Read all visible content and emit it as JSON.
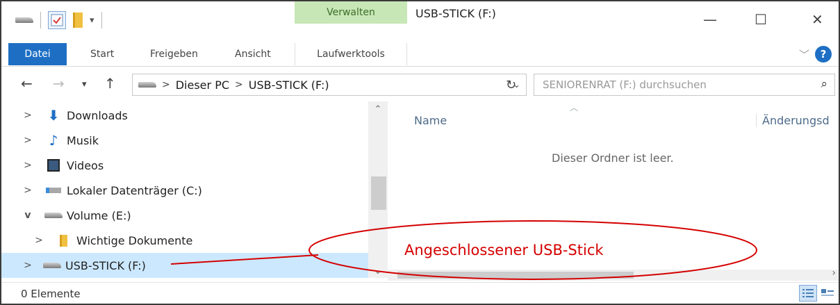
{
  "window": {
    "title": "USB-STICK (F:)",
    "contextual_group": "Verwalten",
    "controls": {
      "minimize": "—",
      "maximize": "☐",
      "close": "✕"
    }
  },
  "ribbon": {
    "tabs": [
      "Datei",
      "Start",
      "Freigeben",
      "Ansicht"
    ],
    "contextual_tab": "Laufwerktools",
    "help": "?"
  },
  "address": {
    "root": "Dieser PC",
    "current": "USB-STICK (F:)",
    "separator": ">",
    "search_placeholder": "SENIORENRAT (F:) durchsuchen"
  },
  "nav_tree": [
    {
      "label": "Downloads",
      "expander": ">",
      "icon": "download-icon",
      "indent": 0
    },
    {
      "label": "Musik",
      "expander": ">",
      "icon": "music-icon",
      "indent": 0
    },
    {
      "label": "Videos",
      "expander": ">",
      "icon": "video-icon",
      "indent": 0
    },
    {
      "label": "Lokaler Datenträger (C:)",
      "expander": ">",
      "icon": "local-drive-icon",
      "indent": 0
    },
    {
      "label": "Volume (E:)",
      "expander": "v",
      "icon": "drive-icon",
      "indent": 0
    },
    {
      "label": "Wichtige Dokumente",
      "expander": ">",
      "icon": "folder-icon",
      "indent": 1
    },
    {
      "label": "USB-STICK (F:)",
      "expander": ">",
      "icon": "usb-drive-icon",
      "indent": 0,
      "selected": true
    }
  ],
  "content": {
    "columns": [
      "Name",
      "Änderungsd"
    ],
    "empty_message": "Dieser Ordner ist leer."
  },
  "status": {
    "item_count": "0 Elemente"
  },
  "annotation": {
    "text": "Angeschlossener USB-Stick",
    "color": "#d40000"
  },
  "colors": {
    "accent": "#1e6fc4",
    "context_group": "#c7e7b6",
    "selected_row": "#cce8ff"
  }
}
